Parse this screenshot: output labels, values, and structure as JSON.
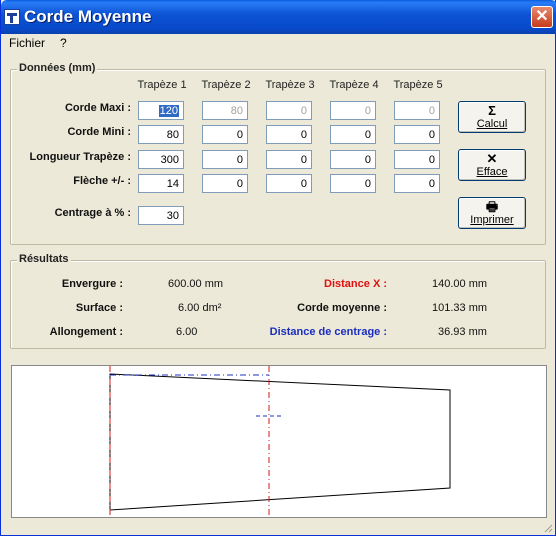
{
  "window": {
    "title": "Corde Moyenne",
    "close_glyph": "✕"
  },
  "menu": {
    "items": [
      "Fichier",
      "?"
    ]
  },
  "donnees": {
    "title": "Données (mm)",
    "columns": [
      "Trapèze 1",
      "Trapèze 2",
      "Trapèze 3",
      "Trapèze 4",
      "Trapèze 5"
    ],
    "rows": [
      {
        "label": "Corde Maxi :",
        "values": [
          "120",
          "80",
          "0",
          "0",
          "0"
        ]
      },
      {
        "label": "Corde Mini :",
        "values": [
          "80",
          "0",
          "0",
          "0",
          "0"
        ]
      },
      {
        "label": "Longueur Trapèze :",
        "values": [
          "300",
          "0",
          "0",
          "0",
          "0"
        ]
      },
      {
        "label": "Flèche  +/- :",
        "values": [
          "14",
          "0",
          "0",
          "0",
          "0"
        ]
      }
    ],
    "centrage_label": "Centrage à  % :",
    "centrage_value": "30"
  },
  "buttons": {
    "calcul": {
      "glyph": "Σ",
      "label": "Calcul"
    },
    "efface": {
      "glyph": "✕",
      "label": "Efface"
    },
    "imprimer": {
      "glyph": "🖶",
      "label": "Imprimer"
    }
  },
  "resultats": {
    "title": "Résultats",
    "envergure_label": "Envergure :",
    "envergure_value": "600.00 mm",
    "surface_label": "Surface :",
    "surface_value": "6.00 dm²",
    "allongement_label": "Allongement :",
    "allongement_value": "6.00",
    "distance_x_label": "Distance X :",
    "distance_x_value": "140.00 mm",
    "corde_moyenne_label": "Corde moyenne :",
    "corde_moyenne_value": "101.33 mm",
    "distance_centrage_label": "Distance de centrage :",
    "distance_centrage_value": "36.93 mm"
  },
  "colors": {
    "distance_x": "#e01010",
    "distance_centrage": "#1a2dbf",
    "axis_line": "#d01818",
    "centrage_line": "#2030c0"
  }
}
